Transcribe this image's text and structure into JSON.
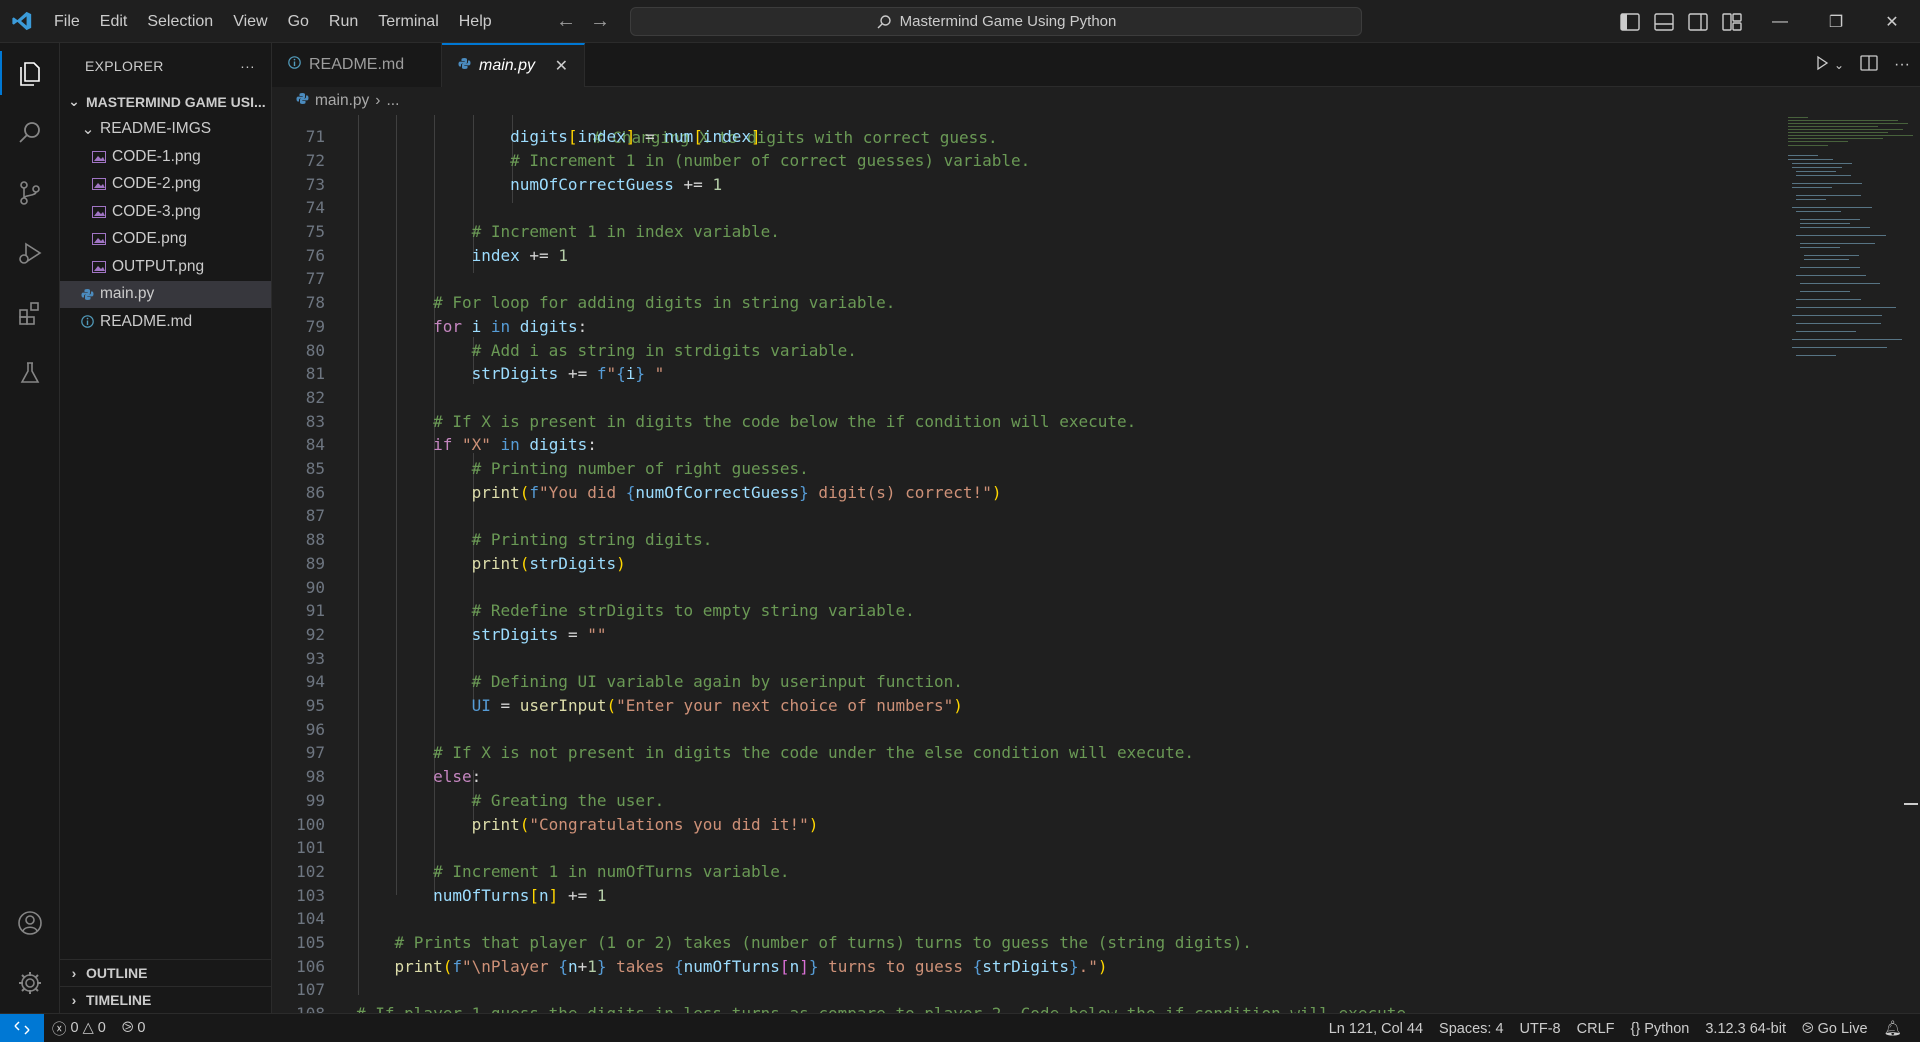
{
  "titlebar": {
    "menu": [
      "File",
      "Edit",
      "Selection",
      "View",
      "Go",
      "Run",
      "Terminal",
      "Help"
    ],
    "search_text": "Mastermind Game Using Python"
  },
  "sidebar": {
    "title": "EXPLORER",
    "root": "MASTERMIND GAME USI...",
    "folder": "README-IMGS",
    "folder_files": [
      "CODE-1.png",
      "CODE-2.png",
      "CODE-3.png",
      "CODE.png",
      "OUTPUT.png"
    ],
    "files": [
      "main.py",
      "README.md"
    ],
    "outline": "OUTLINE",
    "timeline": "TIMELINE"
  },
  "tabs": {
    "readme": "README.md",
    "main": "main.py"
  },
  "breadcrumb": {
    "file": "main.py",
    "rest": "..."
  },
  "editor": {
    "line_numbers": [
      "71",
      "72",
      "73",
      "74",
      "75",
      "76",
      "77",
      "78",
      "79",
      "80",
      "81",
      "82",
      "83",
      "84",
      "85",
      "86",
      "87",
      "88",
      "89",
      "90",
      "91",
      "92",
      "93",
      "94",
      "95",
      "96",
      "97",
      "98",
      "99",
      "100",
      "101",
      "102",
      "103",
      "104",
      "105",
      "106",
      "107",
      "108"
    ],
    "partial_top_comment": "# Changing X to digits with correct guess.",
    "partial_bottom_comment": "# If player 1 guess the digits in less turns as compare to player 2. Code below the if condition will execute."
  },
  "statusbar": {
    "errors": "0",
    "warnings": "0",
    "ports": "0",
    "position": "Ln 121, Col 44",
    "spaces": "Spaces: 4",
    "encoding": "UTF-8",
    "eol": "CRLF",
    "language": "Python",
    "interpreter": "3.12.3 64-bit",
    "golive": "Go Live"
  },
  "colors": {
    "accent": "#0078d4",
    "background": "#1f1f1f",
    "sidebar": "#181818"
  }
}
